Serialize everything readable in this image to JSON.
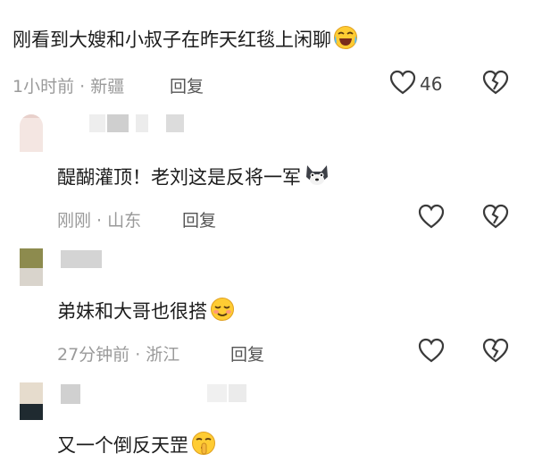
{
  "comments": [
    {
      "text": "刚看到大嫂和小叔子在昨天红毯上闲聊",
      "emoji": "crying-laughing-emoji",
      "meta": "1小时前 · 新疆",
      "reply_label": "回复",
      "like_count": "46"
    },
    {
      "text": "醍醐灌顶！老刘这是反将一军",
      "emoji": "dog-emoji",
      "meta": "刚刚 · 山东",
      "reply_label": "回复"
    },
    {
      "text": "弟妹和大哥也很搭",
      "emoji": "blushing-smile-emoji",
      "meta": "27分钟前 · 浙江",
      "reply_label": "回复"
    },
    {
      "text": "又一个倒反天罡",
      "emoji": "shushing-emoji"
    }
  ],
  "colors": {
    "text": "#1c1c1c",
    "meta": "#9a9a9a",
    "icon": "#3a3a3a"
  }
}
